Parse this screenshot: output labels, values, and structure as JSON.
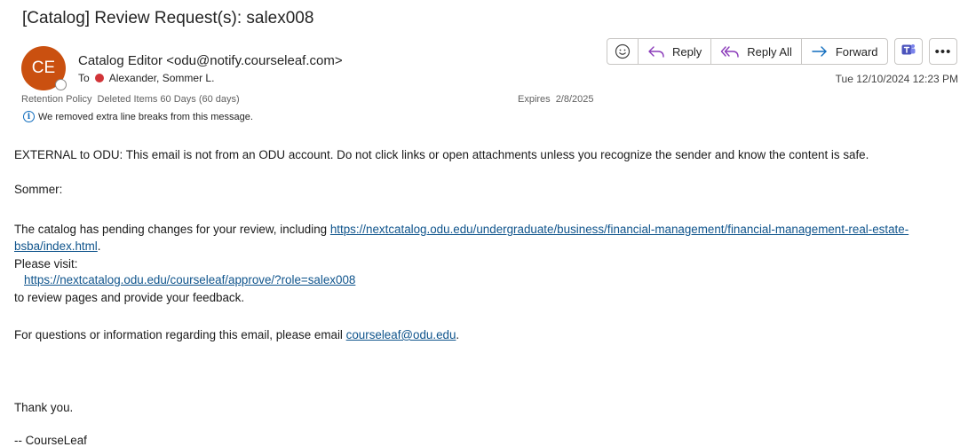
{
  "email": {
    "subject": "[Catalog] Review Request(s): salex008",
    "avatar_initials": "CE",
    "avatar_color": "#ca5010",
    "sender": "Catalog Editor <odu@notify.courseleaf.com>",
    "to_label": "To",
    "recipient": "Alexander, Sommer L.",
    "retention_label": "Retention Policy",
    "retention_value": "Deleted Items 60 Days (60 days)",
    "expires_label": "Expires",
    "expires_value": "2/8/2025",
    "info_notice": "We removed extra line breaks from this message.",
    "date": "Tue 12/10/2024 12:23 PM"
  },
  "actions": {
    "reply": "Reply",
    "reply_all": "Reply All",
    "forward": "Forward"
  },
  "body": {
    "external_warning": "EXTERNAL to ODU: This email is not from an ODU account. Do not click links or open attachments unless you recognize the sender and know the content is safe.",
    "greeting": "Sommer:",
    "intro_text": "The catalog has pending changes for your review, including ",
    "intro_link": "https://nextcatalog.odu.edu/undergraduate/business/financial-management/financial-management-real-estate-bsba/index.html",
    "intro_end": ".",
    "visit_text": "Please visit:",
    "approve_link": "https://nextcatalog.odu.edu/courseleaf/approve/?role=salex008",
    "review_text": "to review pages and provide your feedback.",
    "questions_text": "For questions or information regarding this email, please email ",
    "questions_email": "courseleaf@odu.edu",
    "questions_end": ".",
    "thanks": "Thank you.",
    "signature": "-- CourseLeaf"
  }
}
